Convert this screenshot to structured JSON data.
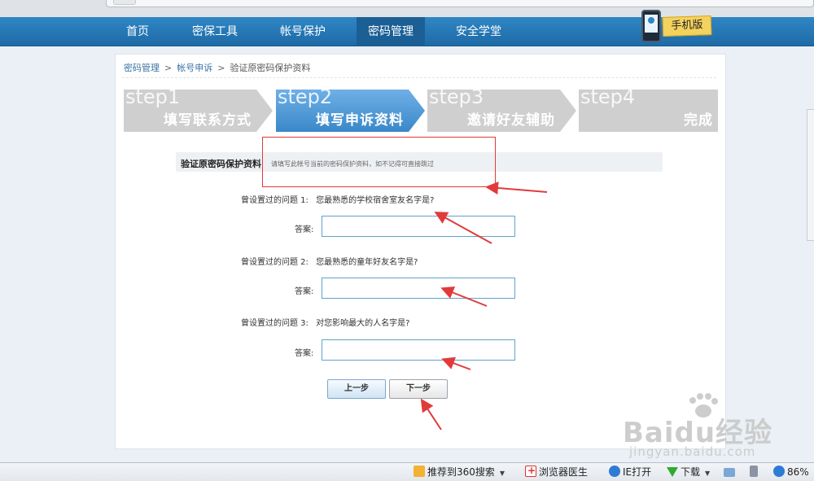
{
  "nav": {
    "items": [
      {
        "label": "首页"
      },
      {
        "label": "密保工具"
      },
      {
        "label": "帐号保护"
      },
      {
        "label": "密码管理"
      },
      {
        "label": "安全学堂"
      }
    ],
    "active_index": 3,
    "mobile_label": "手机版"
  },
  "breadcrumb": {
    "items": [
      "密码管理",
      "帐号申诉",
      "验证原密码保护资料"
    ],
    "separator": ">"
  },
  "steps": [
    {
      "num": "step1",
      "label": "填写联系方式",
      "active": false
    },
    {
      "num": "step2",
      "label": "填写申诉资料",
      "active": true
    },
    {
      "num": "step3",
      "label": "邀请好友辅助",
      "active": false
    },
    {
      "num": "step4",
      "label": "完成",
      "active": false
    }
  ],
  "section": {
    "title": "验证原密码保护资料",
    "hint": "请填写此帐号当前的密码保护资料，如不记得可直接跳过"
  },
  "questions": [
    {
      "prefix": "曾设置过的问题 1:",
      "text": "您最熟悉的学校宿舍室友名字是?",
      "answer_label": "答案:",
      "value": ""
    },
    {
      "prefix": "曾设置过的问题 2:",
      "text": "您最熟悉的童年好友名字是?",
      "answer_label": "答案:",
      "value": ""
    },
    {
      "prefix": "曾设置过的问题 3:",
      "text": "对您影响最大的人名字是?",
      "answer_label": "答案:",
      "value": ""
    }
  ],
  "buttons": {
    "prev": "上一步",
    "next": "下一步"
  },
  "statusbar": {
    "recommend": "推荐到360搜索",
    "doctor": "浏览器医生",
    "ie_open": "IE打开",
    "download": "下载",
    "zoom": "86%"
  },
  "watermark": {
    "brand": "Baidu经验",
    "url": "jingyan.baidu.com"
  },
  "colors": {
    "nav": "#2f86c5",
    "step_active": "#3a88c9",
    "step_inactive": "#cfcfcf",
    "annotation": "#e23a3a"
  }
}
